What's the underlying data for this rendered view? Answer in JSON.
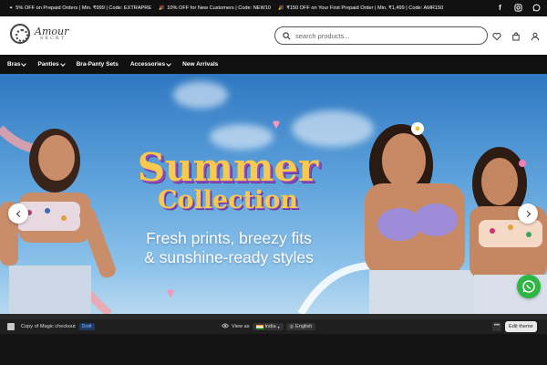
{
  "announcement": {
    "offers": [
      {
        "icon": "sparkle-icon",
        "text": "5% OFF on Prepaid Orders | Min. ₹999 | Code: EXTRAPRE"
      },
      {
        "icon": "party-icon",
        "text": "10% OFF for New Customers | Code: NEW10"
      },
      {
        "icon": "party-icon",
        "text": "₹150 OFF on Your First Prepaid Order | Min. ₹1,499 | Code: AMR150"
      }
    ],
    "social": [
      "facebook-icon",
      "instagram-icon",
      "whatsapp-icon"
    ]
  },
  "header": {
    "logo_line1": "Amour",
    "logo_line2": "SECRT",
    "search_placeholder": "search products...",
    "icons": [
      "heart-icon",
      "cart-icon",
      "user-icon"
    ]
  },
  "nav": {
    "items": [
      {
        "label": "Bras",
        "dropdown": true
      },
      {
        "label": "Panties",
        "dropdown": true
      },
      {
        "label": "Bra-Panty Sets",
        "dropdown": false
      },
      {
        "label": "Accessories",
        "dropdown": true
      },
      {
        "label": "New Arrivals",
        "dropdown": false
      }
    ]
  },
  "hero": {
    "title_line1": "Summer",
    "title_line2": "Collection",
    "subtitle_line1": "Fresh prints, breezy fits",
    "subtitle_line2": "& sunshine-ready styles",
    "colors": {
      "title": "#f7c94c",
      "title_shadow": "#8e4fbd",
      "sky": "#2f78c2"
    }
  },
  "editor_bar": {
    "store_name": "Copy of Magic checkout",
    "status": "Draft",
    "view_as_label": "View as",
    "country": "India",
    "language": "English",
    "more": "•••",
    "edit_theme": "Edit theme"
  }
}
